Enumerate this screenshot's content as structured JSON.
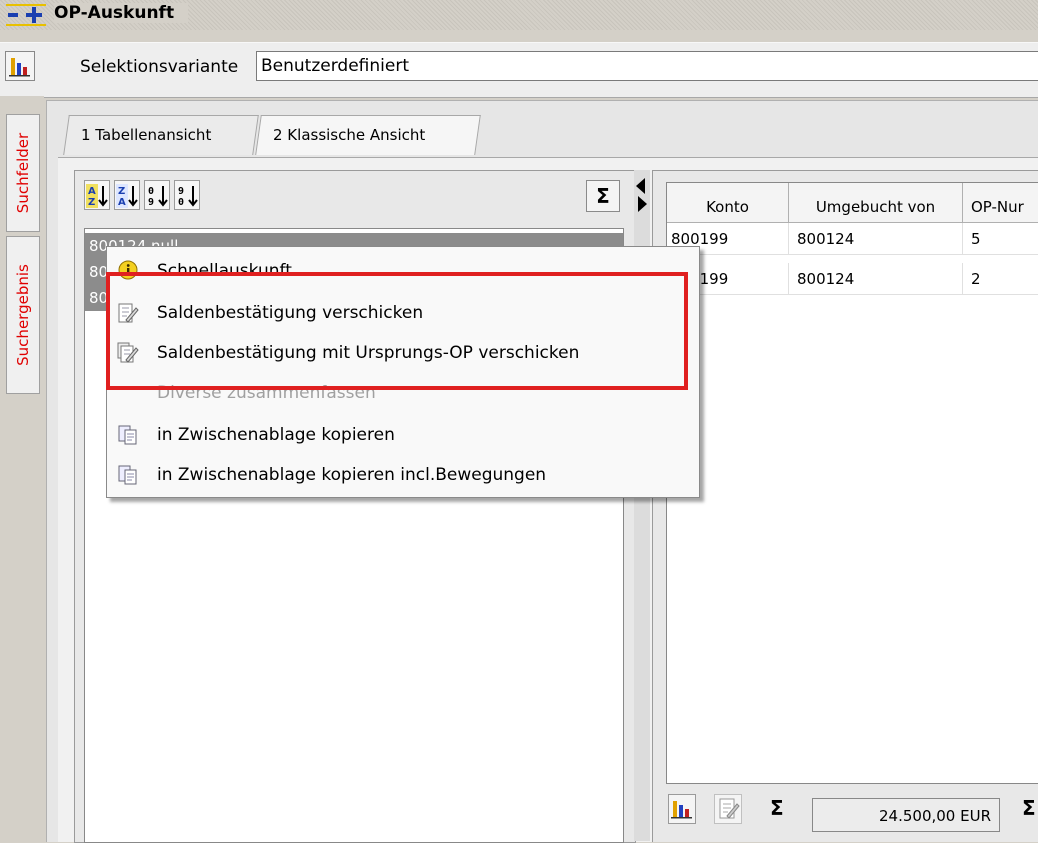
{
  "window": {
    "title": "OP-Auskunft"
  },
  "selection": {
    "label": "Selektionsvariante",
    "value": "Benutzerdefiniert"
  },
  "vertical_tabs": [
    "Suchfelder",
    "Suchergebnis"
  ],
  "tabs": [
    "1 Tabellenansicht",
    "2 Klassische Ansicht"
  ],
  "left_list": {
    "rows": [
      "800124 null",
      "80",
      "80"
    ]
  },
  "context_menu": {
    "items": [
      {
        "label": "Schnellauskunft",
        "icon": "info-icon",
        "disabled": false
      },
      {
        "label": "Saldenbestätigung verschicken",
        "icon": "edit-document-icon",
        "disabled": false
      },
      {
        "label": "Saldenbestätigung mit Ursprungs-OP verschicken",
        "icon": "edit-documents-icon",
        "disabled": false
      },
      {
        "label": "Diverse zusammenfassen",
        "icon": "",
        "disabled": true
      },
      {
        "label": "in Zwischenablage kopieren",
        "icon": "clipboard-copy-icon",
        "disabled": false
      },
      {
        "label": "in Zwischenablage kopieren incl.Bewegungen",
        "icon": "clipboard-copy-icon",
        "disabled": false
      }
    ]
  },
  "table": {
    "headers": [
      "Konto",
      "Umgebucht von",
      "OP-Nur"
    ],
    "rows": [
      [
        "800199",
        "800124",
        "5"
      ],
      [
        "800199",
        "800124",
        "2"
      ]
    ]
  },
  "summary": {
    "sigma": "Σ",
    "total": "24.500,00 EUR"
  },
  "colors": {
    "highlight": "#e02020",
    "tab_label": "#e00000"
  }
}
